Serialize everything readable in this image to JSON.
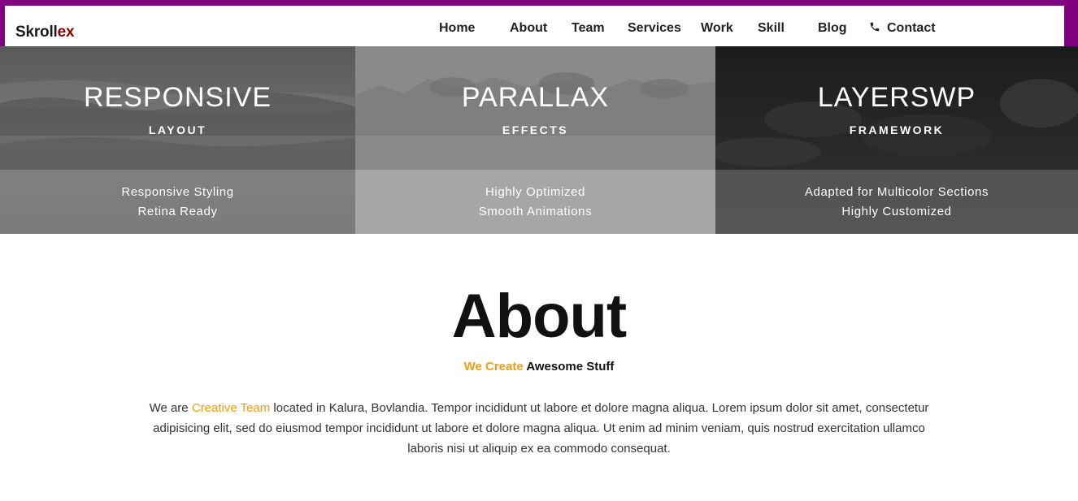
{
  "brand": {
    "prefix": "Skroll",
    "suffix": "ex"
  },
  "nav": {
    "items": [
      {
        "label": "Home"
      },
      {
        "label": "About"
      },
      {
        "label": "Team"
      },
      {
        "label": "Services"
      },
      {
        "label": "Work"
      },
      {
        "label": "Skill"
      },
      {
        "label": "Blog"
      },
      {
        "label": "Contact",
        "icon": "phone-icon"
      }
    ]
  },
  "features": [
    {
      "title": "RESPONSIVE",
      "subtitle": "LAYOUT",
      "lines": [
        "Responsive Styling",
        "Retina Ready"
      ]
    },
    {
      "title": "PARALLAX",
      "subtitle": "EFFECTS",
      "lines": [
        "Highly Optimized",
        "Smooth Animations"
      ]
    },
    {
      "title": "LAYERSWP",
      "subtitle": "FRAMEWORK",
      "lines": [
        "Adapted for Multicolor Sections",
        "Highly Customized"
      ]
    }
  ],
  "about": {
    "title": "About",
    "tagline_highlight": "We Create",
    "tagline_rest": " Awesome Stuff",
    "text_before": "We are ",
    "text_highlight": "Creative Team",
    "text_after": " located in Kalura, Bovlandia. Tempor incididunt ut labore et dolore magna aliqua. Lorem ipsum dolor sit amet, consectetur adipisicing elit, sed do eiusmod tempor incididunt ut labore et dolore magna aliqua. Ut enim ad minim veniam, quis nostrud exercitation ullamco laboris nisi ut aliquip ex ea commodo consequat."
  },
  "colors": {
    "header_frame": "#800080",
    "brand_accent": "#8b0000",
    "highlight": "#f39c12"
  }
}
